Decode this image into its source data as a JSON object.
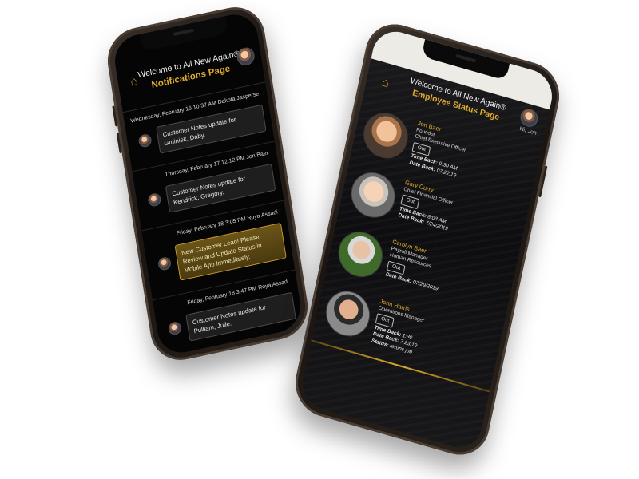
{
  "left_phone": {
    "header": {
      "title": "Welcome to All New Again®",
      "subtitle": "Notifications Page"
    },
    "notifications": [
      {
        "meta": "Wednesday, February 16 10:37 AM Dakota Jasperse",
        "message": "Customer Notes update for Gminiek, Daby.",
        "highlight": false
      },
      {
        "meta": "Thursday, February 17 12:12 PM Jon Baer",
        "message": "Customer Notes update for Kendrick, Gregory.",
        "highlight": false
      },
      {
        "meta": "Friday, February 18 3:05 PM Roya Assadi",
        "message": "New Customer Lead! Please Review and Update Status in Mobile App Immediately.",
        "highlight": true
      },
      {
        "meta": "Friday, February 18 3:47 PM Roya Assadi",
        "message": "Customer Notes update for Pulliam, Julie.",
        "highlight": false
      }
    ]
  },
  "right_phone": {
    "header": {
      "title": "Welcome to All New Again®",
      "subtitle": "Employee Status Page",
      "greeting": "Hi, Jon"
    },
    "employees": [
      {
        "name": "Jon Baer",
        "role1": "Founder",
        "role2": "Chief Executive Officer",
        "status_button": "Out",
        "details": [
          {
            "label": "Time Back:",
            "value": "9:30 AM"
          },
          {
            "label": "Date Back:",
            "value": "07.22.19"
          }
        ]
      },
      {
        "name": "Gary Curry",
        "role1": "Chief Financial Officer",
        "role2": "",
        "status_button": "Out",
        "details": [
          {
            "label": "Time Back:",
            "value": "8:03 AM"
          },
          {
            "label": "Date Back:",
            "value": "7/24/2019"
          }
        ]
      },
      {
        "name": "Carolyn Baer",
        "role1": "Payroll Manager",
        "role2": "Human Resources",
        "status_button": "Out",
        "details": [
          {
            "label": "Date Back:",
            "value": "07/29/2019"
          }
        ]
      },
      {
        "name": "John Harris",
        "role1": "Operations Manager",
        "role2": "",
        "status_button": "Out",
        "details": [
          {
            "label": "Time Back:",
            "value": "1:30"
          },
          {
            "label": "Date Back:",
            "value": "7.23.19"
          },
          {
            "label": "Status:",
            "value": "rerunc job"
          }
        ]
      }
    ]
  },
  "colors": {
    "accent_gold": "#e0ac30",
    "background": "#060606",
    "lead_bubble": "#6a5418"
  },
  "icons": {
    "logo": "house-logo-icon",
    "avatar": "user-avatar"
  }
}
